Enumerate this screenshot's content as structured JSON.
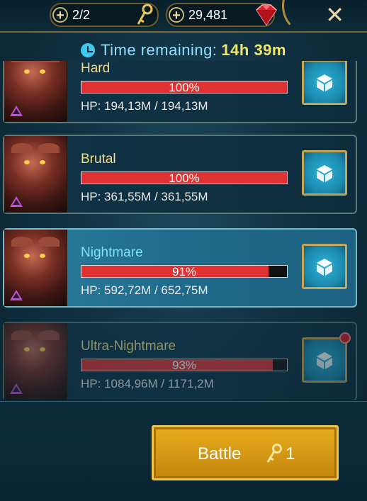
{
  "header": {
    "keys": "2/2",
    "gems": "29,481"
  },
  "timer": {
    "label": "Time remaining:",
    "value": "14h 39m"
  },
  "difficulties": [
    {
      "name": "Hard",
      "percent": "100%",
      "fill": 1.0,
      "hp": "HP: 194,13M / 194,13M",
      "state": "normal"
    },
    {
      "name": "Brutal",
      "percent": "100%",
      "fill": 1.0,
      "hp": "HP: 361,55M / 361,55M",
      "state": "normal"
    },
    {
      "name": "Nightmare",
      "percent": "91%",
      "fill": 0.91,
      "hp": "HP: 592,72M / 652,75M",
      "state": "selected"
    },
    {
      "name": "Ultra-Nightmare",
      "percent": "93%",
      "fill": 0.93,
      "hp": "HP: 1084,96M / 1171,2M",
      "state": "locked"
    }
  ],
  "battle": {
    "label": "Battle",
    "cost": "1"
  },
  "colors": {
    "accent_gold": "#f0c54a",
    "bar_red": "#e03232",
    "timer_value": "#f0e66a",
    "selected_name": "#7ee0ff"
  }
}
